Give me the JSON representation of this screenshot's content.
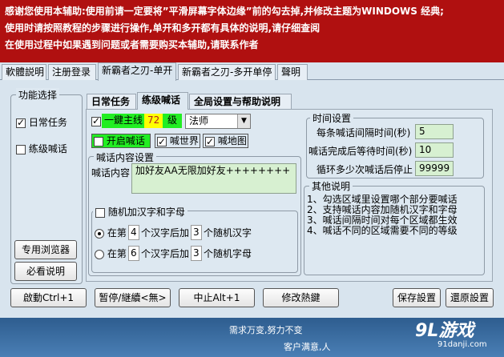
{
  "banner": {
    "line1": "感谢您使用本辅助:使用前请一定要将”平滑屏幕字体边缘”前的勾去掉,并修改主题为WINDOWS 经典;",
    "line2": "使用时请按照教程的步骤进行操作,单开和多开都有具体的说明,请仔细查阅",
    "line3": "在使用过程中如果遇到问题或者需要购买本辅助,请联系作者"
  },
  "outer_tabs": [
    "軟體説明",
    "注册登录",
    "新霸者之刃-单开",
    "新霸者之刃-多开单停",
    "聲明"
  ],
  "left_panel": {
    "legend": "功能选择",
    "daily_task": "日常任务",
    "practice_shout": "练级喊话",
    "browser_button": "专用浏览器",
    "must_read_button": "必看说明"
  },
  "inner_tabs": [
    "日常任务",
    "练级喊话",
    "全局设置与帮助说明"
  ],
  "level_row": {
    "mainline_label": "一鍵主线",
    "level_value": "72",
    "level_unit": "级",
    "class_value": "法师",
    "open_shout": "开启喊话",
    "shout_world": "喊世界",
    "shout_map": "喊地图"
  },
  "shout_content": {
    "legend": "喊话内容设置",
    "content_label": "喊话内容",
    "content_value": "加好友AA无限加好友++++++++",
    "random_label": "随机加汉字和字母",
    "row1_pre": "在第",
    "row1_n": "4",
    "row1_mid": "个汉字后加",
    "row1_m": "3",
    "row1_post": "个随机汉字",
    "row2_pre": "在第",
    "row2_n": "6",
    "row2_mid": "个汉字后加",
    "row2_m": "3",
    "row2_post": "个随机字母"
  },
  "time_settings": {
    "legend": "时间设置",
    "interval_label": "每条喊话间隔时间(秒)",
    "interval_value": "5",
    "wait_label": "喊话完成后等待时间(秒)",
    "wait_value": "10",
    "loop_label": "循环多少次喊话后停止",
    "loop_value": "99999"
  },
  "other_notes": {
    "legend": "其他说明",
    "lines": [
      "1、勾选区域里设置哪个部分要喊话",
      "2、支持喊话内容加随机汉字和字母",
      "3、喊话间隔时间对每个区域都生效",
      "4、喊话不同的区域需要不同的等级"
    ]
  },
  "buttons": {
    "start": "啟動Ctrl+1",
    "pause": "暂停/継續<無>",
    "stop": "中止Alt+1",
    "hotkey": "修改熱鍵",
    "save": "保存設置",
    "restore": "還原設置"
  },
  "footer": {
    "slogan": "需求万变,努力不变",
    "slogan2": "客户满意,人",
    "logo": "9L游戏",
    "site": "91danji.com"
  },
  "colors": {
    "banner_bg": "#b01010",
    "panel_bg": "#d8e4ee",
    "field_bg": "#d7f0d1",
    "highlight_green": "#22ee22",
    "highlight_yellow": "#ffff00"
  }
}
